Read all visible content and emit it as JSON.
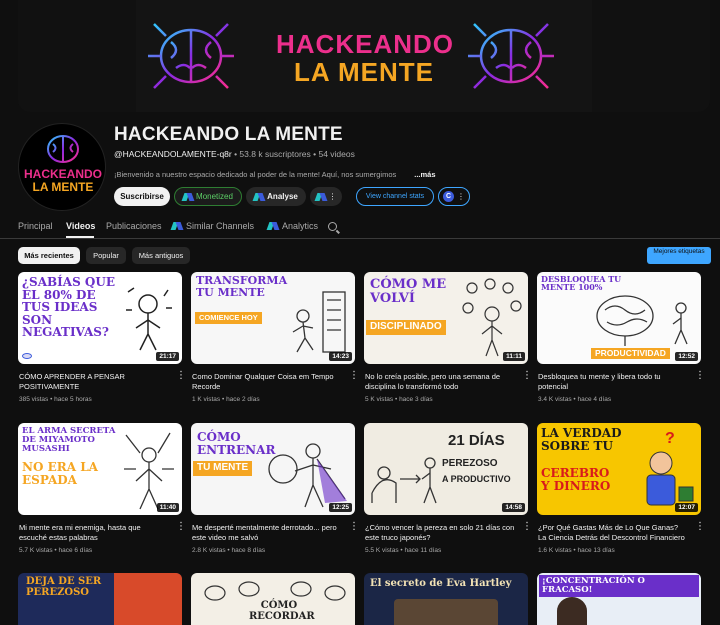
{
  "banner": {
    "line1": "HACKEANDO",
    "line2": "LA MENTE"
  },
  "channel": {
    "avatar_line1": "HACKEANDO",
    "avatar_line2": "LA MENTE",
    "title": "HACKEANDO LA MENTE",
    "handle": "@HACKEANDOLAMENTE-q8r",
    "meta": " • 53.8 k suscriptores • 54 videos",
    "description": "¡Bienvenido a nuestro espacio dedicado al poder de la mente! Aquí, nos sumergimos",
    "more": "...más"
  },
  "buttons": {
    "subscribe": "Suscribirse",
    "monetized": "Monetized",
    "analyse": "Analyse",
    "stats": "View channel stats",
    "ext_letter": "C"
  },
  "tabs": [
    {
      "label": "Principal"
    },
    {
      "label": "Videos"
    },
    {
      "label": "Publicaciones"
    },
    {
      "label": "Similar Channels"
    },
    {
      "label": "Analytics"
    }
  ],
  "chips": [
    "Más recientes",
    "Popular",
    "Más antiguos"
  ],
  "better_tags": "Mejores etiquetas",
  "videos": [
    {
      "thumb_text": "¿SABÍAS QUE EL 80% DE TUS IDEAS SON NEGATIVAS?",
      "duration": "21:17",
      "title": "CÓMO APRENDER A PENSAR POSITIVAMENTE",
      "meta": "385 vistas • hace 5 horas"
    },
    {
      "thumb_text_a": "TRANSFORMA TU MENTE",
      "thumb_text_b": "COMIENCE HOY",
      "duration": "14:23",
      "title": "Como Dominar Qualquer Coisa em Tempo Recorde",
      "meta": "1 K vistas • hace 2 días"
    },
    {
      "thumb_text_a": "CÓMO ME VOLVÍ",
      "thumb_text_b": "DISCIPLINADO",
      "duration": "11:11",
      "title": "No lo creía posible, pero una semana de disciplina lo transformó todo",
      "meta": "5 K vistas • hace 3 días"
    },
    {
      "thumb_text_a": "DESBLOQUEA TU MENTE 100%",
      "thumb_text_b": "PRODUCTIVIDAD",
      "duration": "12:52",
      "title": "Desbloquea tu mente y libera todo tu potencial",
      "meta": "3.4 K vistas • hace 4 días"
    },
    {
      "thumb_text_a": "EL ARMA SECRETA DE MIYAMOTO MUSASHI",
      "thumb_text_b": "NO ERA LA ESPADA",
      "duration": "11:40",
      "title": "Mi mente era mi enemiga, hasta que escuché estas palabras",
      "meta": "5.7 K vistas • hace 6 días"
    },
    {
      "thumb_text_a": "CÓMO ENTRENAR",
      "thumb_text_b": "TU MENTE",
      "duration": "12:25",
      "title": "Me desperté mentalmente derrotado... pero este video me salvó",
      "meta": "2.8 K vistas • hace 8 días"
    },
    {
      "thumb_text_a": "21 DÍAS",
      "thumb_text_b": "PEREZOSO",
      "thumb_text_c": "A PRODUCTIVO",
      "duration": "14:58",
      "title": "¿Cómo vencer la pereza en solo 21 días con este truco japonés?",
      "meta": "5.5 K vistas • hace 11 días"
    },
    {
      "thumb_text_a": "LA VERDAD SOBRE TU",
      "thumb_text_b": "CEREBRO Y DINERO",
      "duration": "12:07",
      "title": "¿Por Qué Gastas Más de Lo Que Ganas? La Ciencia Detrás del Descontrol Financiero",
      "meta": "1.6 K vistas • hace 13 días"
    }
  ],
  "bottom_thumbs": [
    {
      "text": "DEJA DE SER PEREZOSO"
    },
    {
      "text": "CÓMO RECORDAR"
    },
    {
      "text": "El secreto de Eva Hartley"
    },
    {
      "text": "¡CONCENTRACIÓN O FRACASO!"
    }
  ],
  "colors": {
    "accent_blue": "#3ea6ff",
    "pink": "#ec2f8c",
    "orange": "#f5a623",
    "purple": "#6a2fc9"
  }
}
